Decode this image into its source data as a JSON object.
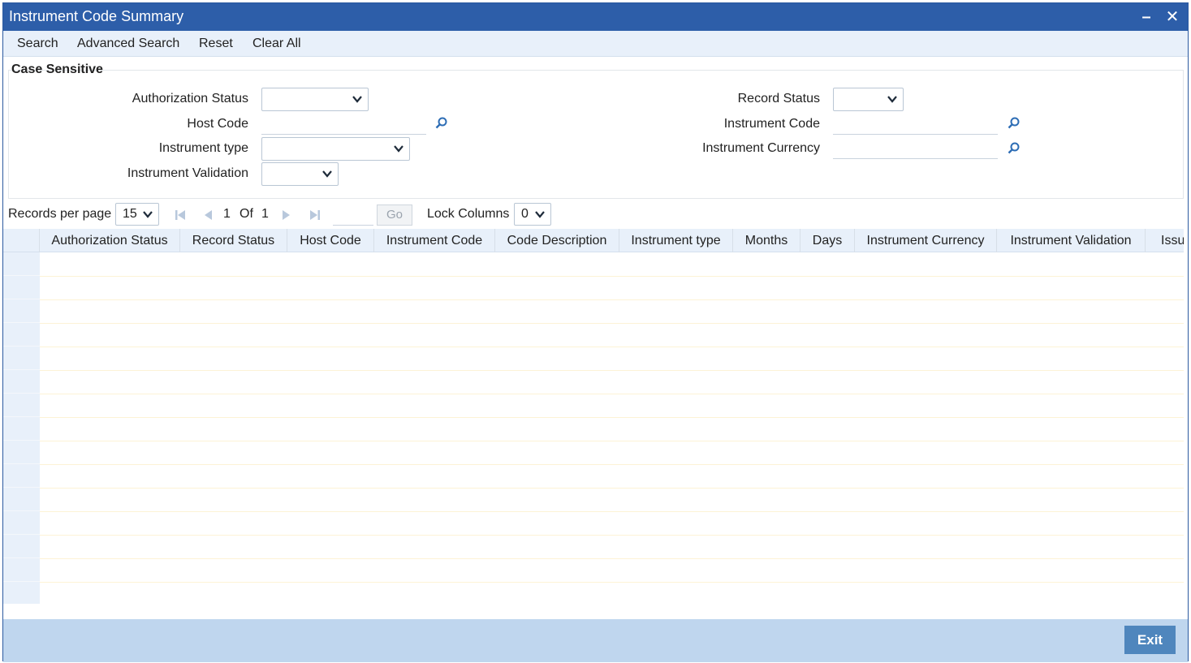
{
  "window": {
    "title": "Instrument Code Summary",
    "minimize_glyph": "–",
    "close_glyph": "✕"
  },
  "toolbar": {
    "search": "Search",
    "advanced_search": "Advanced Search",
    "reset": "Reset",
    "clear_all": "Clear All"
  },
  "criteria": {
    "section_title": "Case Sensitive",
    "authorization_status": {
      "label": "Authorization Status",
      "value": ""
    },
    "record_status": {
      "label": "Record Status",
      "value": ""
    },
    "host_code": {
      "label": "Host Code",
      "value": ""
    },
    "instrument_code": {
      "label": "Instrument Code",
      "value": ""
    },
    "instrument_type": {
      "label": "Instrument type",
      "value": ""
    },
    "instrument_currency": {
      "label": "Instrument Currency",
      "value": ""
    },
    "instrument_validation": {
      "label": "Instrument Validation",
      "value": ""
    }
  },
  "pager": {
    "records_per_page_label": "Records per page",
    "records_per_page_value": "15",
    "current_page": "1",
    "of_label": "Of",
    "total_pages": "1",
    "go_label": "Go",
    "lock_columns_label": "Lock Columns",
    "lock_columns_value": "0"
  },
  "grid": {
    "columns": [
      "Authorization Status",
      "Record Status",
      "Host Code",
      "Instrument Code",
      "Code Description",
      "Instrument type",
      "Months",
      "Days",
      "Instrument Currency",
      "Instrument Validation",
      "Issu"
    ],
    "row_count": 15
  },
  "footer": {
    "exit_label": "Exit"
  },
  "colors": {
    "titlebar": "#2d5ea9",
    "toolbar": "#e8f0fa",
    "footer": "#bfd6ee",
    "exit_button": "#4f86bd",
    "lookup_icon": "#2d6db5"
  },
  "icons": {
    "lookup": "search-icon",
    "dropdown": "chevron-down-icon",
    "first_page": "first-page-icon",
    "prev_page": "prev-page-icon",
    "next_page": "next-page-icon",
    "last_page": "last-page-icon"
  }
}
